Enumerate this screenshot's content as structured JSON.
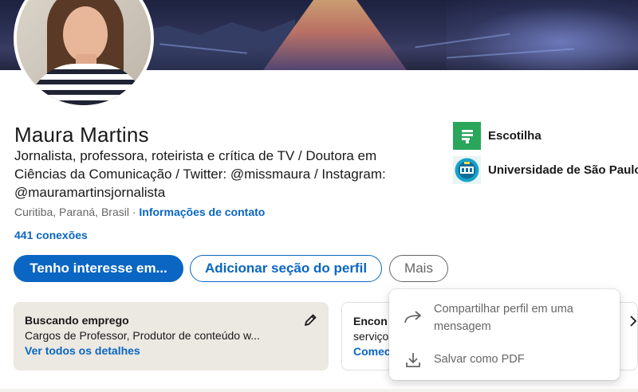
{
  "profile": {
    "name": "Maura Martins",
    "headline": "Jornalista, professora, roteirista e crítica de TV / Doutora em Ciências da Comunicação / Twitter: @missmaura / Instagram: @mauramartinsjornalista",
    "location": "Curitiba, Paraná, Brasil",
    "separator": "·",
    "contact_link": "Informações de contato",
    "connections": "441 conexões"
  },
  "actions": {
    "primary": "Tenho interesse em...",
    "add_section": "Adicionar seção do perfil",
    "more": "Mais"
  },
  "organizations": [
    {
      "label": "Escotilha",
      "icon": "escotilha-logo",
      "color": "#2aa65b"
    },
    {
      "label": "Universidade de São Paulo",
      "icon": "usp-logo",
      "color": "#1aa3c8"
    }
  ],
  "open_to_work": {
    "title": "Buscando emprego",
    "subtitle": "Cargos de Professor, Produtor de conteúdo w...",
    "link": "Ver todos os detalhes"
  },
  "services_card": {
    "title": "Encon",
    "subtitle": "serviço",
    "link": "Comec"
  },
  "more_menu": {
    "items": [
      {
        "label": "Compartilhar perfil em uma mensagem",
        "icon": "share-arrow-icon"
      },
      {
        "label": "Salvar como PDF",
        "icon": "download-icon"
      }
    ]
  },
  "colors": {
    "accent": "#0a66c2",
    "card_bg": "#ece8e2",
    "text": "#191919",
    "muted": "#666666"
  }
}
